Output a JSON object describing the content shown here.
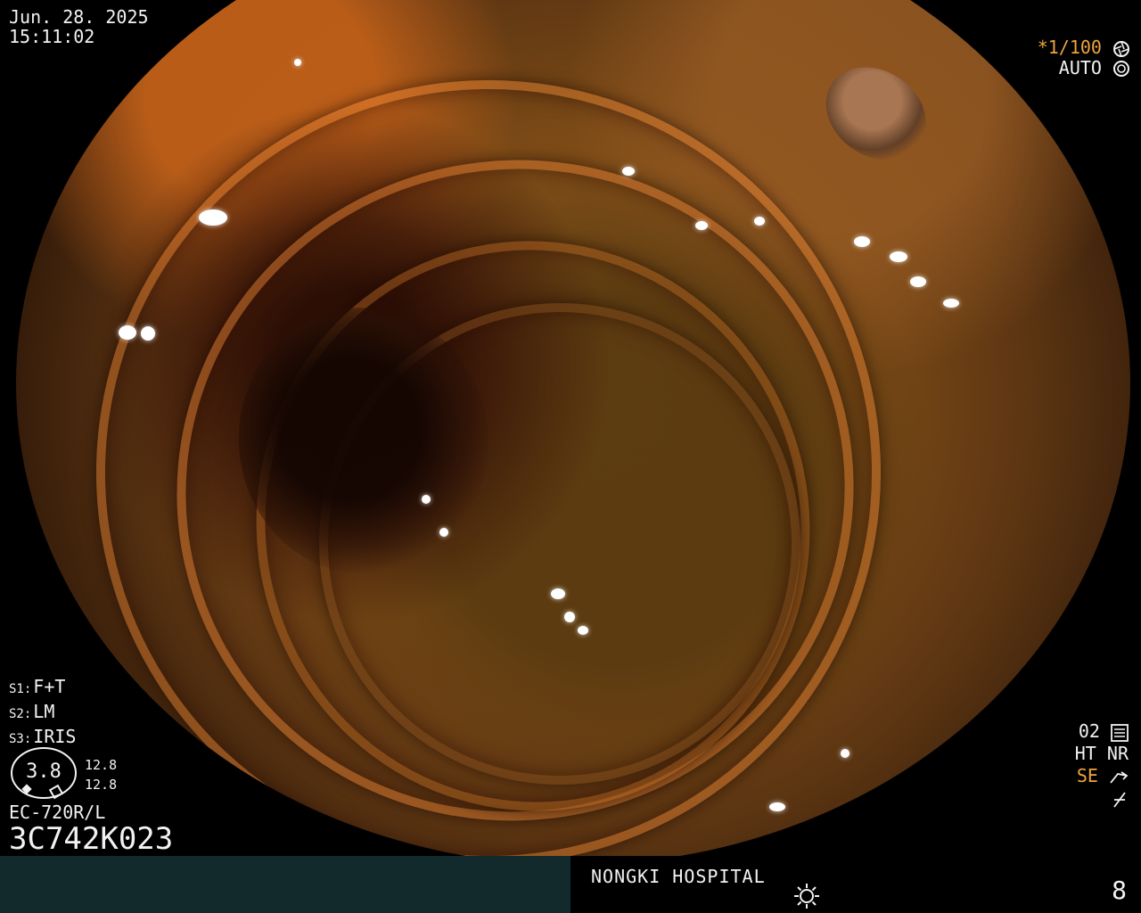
{
  "datetime": {
    "date": "Jun. 28. 2025",
    "time": "15:11:02"
  },
  "exposure": {
    "shutter": "*1/100",
    "mode": "AUTO"
  },
  "scope_settings": {
    "s1": {
      "key": "S1:",
      "value": "F+T"
    },
    "s2": {
      "key": "S2:",
      "value": "LM"
    },
    "s3": {
      "key": "S3:",
      "value": "IRIS"
    }
  },
  "gauge": {
    "main": "3.8",
    "upper": "12.8",
    "lower": "12.8"
  },
  "device": {
    "model": "EC-720R/L",
    "serial": "3C742K023"
  },
  "bottom_right": {
    "line1": "02",
    "ht": "HT",
    "nr": "NR",
    "se": "SE"
  },
  "footer": {
    "hospital": "NONGKI HOSPITAL",
    "page": "8"
  },
  "icons": [
    "aperture-icon",
    "iris-icon",
    "settings-sliders-icon",
    "arrow-icon",
    "flash-off-icon",
    "sun-icon"
  ],
  "colors": {
    "accent": "#f0a33c",
    "footer_left": "#132a2d"
  }
}
